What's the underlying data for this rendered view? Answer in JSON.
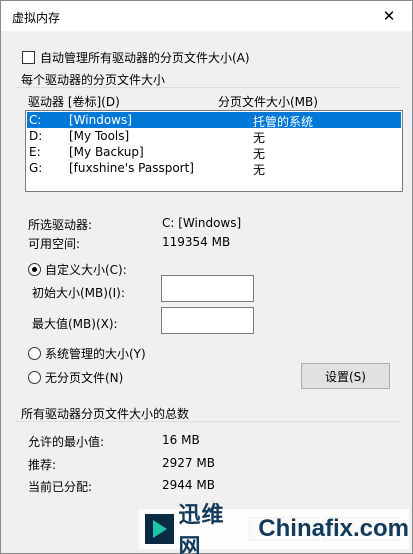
{
  "window": {
    "title": "虚拟内存",
    "close_glyph": "✕"
  },
  "auto_manage": {
    "label": "自动管理所有驱动器的分页文件大小(A)",
    "checked": false
  },
  "drive_group": {
    "label": "每个驱动器的分页文件大小",
    "col_drive": "驱动器 [卷标](D)",
    "col_size": "分页文件大小(MB)",
    "rows": [
      {
        "letter": "C:",
        "label": "[Windows]",
        "size": "托管的系统",
        "selected": true
      },
      {
        "letter": "D:",
        "label": "[My Tools]",
        "size": "无",
        "selected": false
      },
      {
        "letter": "E:",
        "label": "[My Backup]",
        "size": "无",
        "selected": false
      },
      {
        "letter": "G:",
        "label": "[fuxshine's Passport]",
        "size": "无",
        "selected": false
      }
    ],
    "selected_drive_label": "所选驱动器:",
    "selected_drive_value": "C:  [Windows]",
    "free_space_label": "可用空间:",
    "free_space_value": "119354 MB",
    "custom_size": {
      "label": "自定义大小(C):",
      "selected": true
    },
    "initial_size_label": "初始大小(MB)(I):",
    "initial_size_value": "",
    "max_size_label": "最大值(MB)(X):",
    "max_size_value": "",
    "system_managed": {
      "label": "系统管理的大小(Y)",
      "selected": false
    },
    "no_paging": {
      "label": "无分页文件(N)",
      "selected": false
    },
    "set_button": "设置(S)"
  },
  "total_group": {
    "label": "所有驱动器分页文件大小的总数",
    "min_label": "允许的最小值:",
    "min_value": "16 MB",
    "recommended_label": "推荐:",
    "recommended_value": "2927 MB",
    "current_label": "当前已分配:",
    "current_value": "2944 MB"
  },
  "watermark": {
    "cn": "迅维网",
    "en": "Chinafix.com"
  },
  "colors": {
    "selection": "#0078d7",
    "window_bg": "#f0f0f0",
    "brand": "#123a5a",
    "brand_accent": "#1fc6a6"
  }
}
